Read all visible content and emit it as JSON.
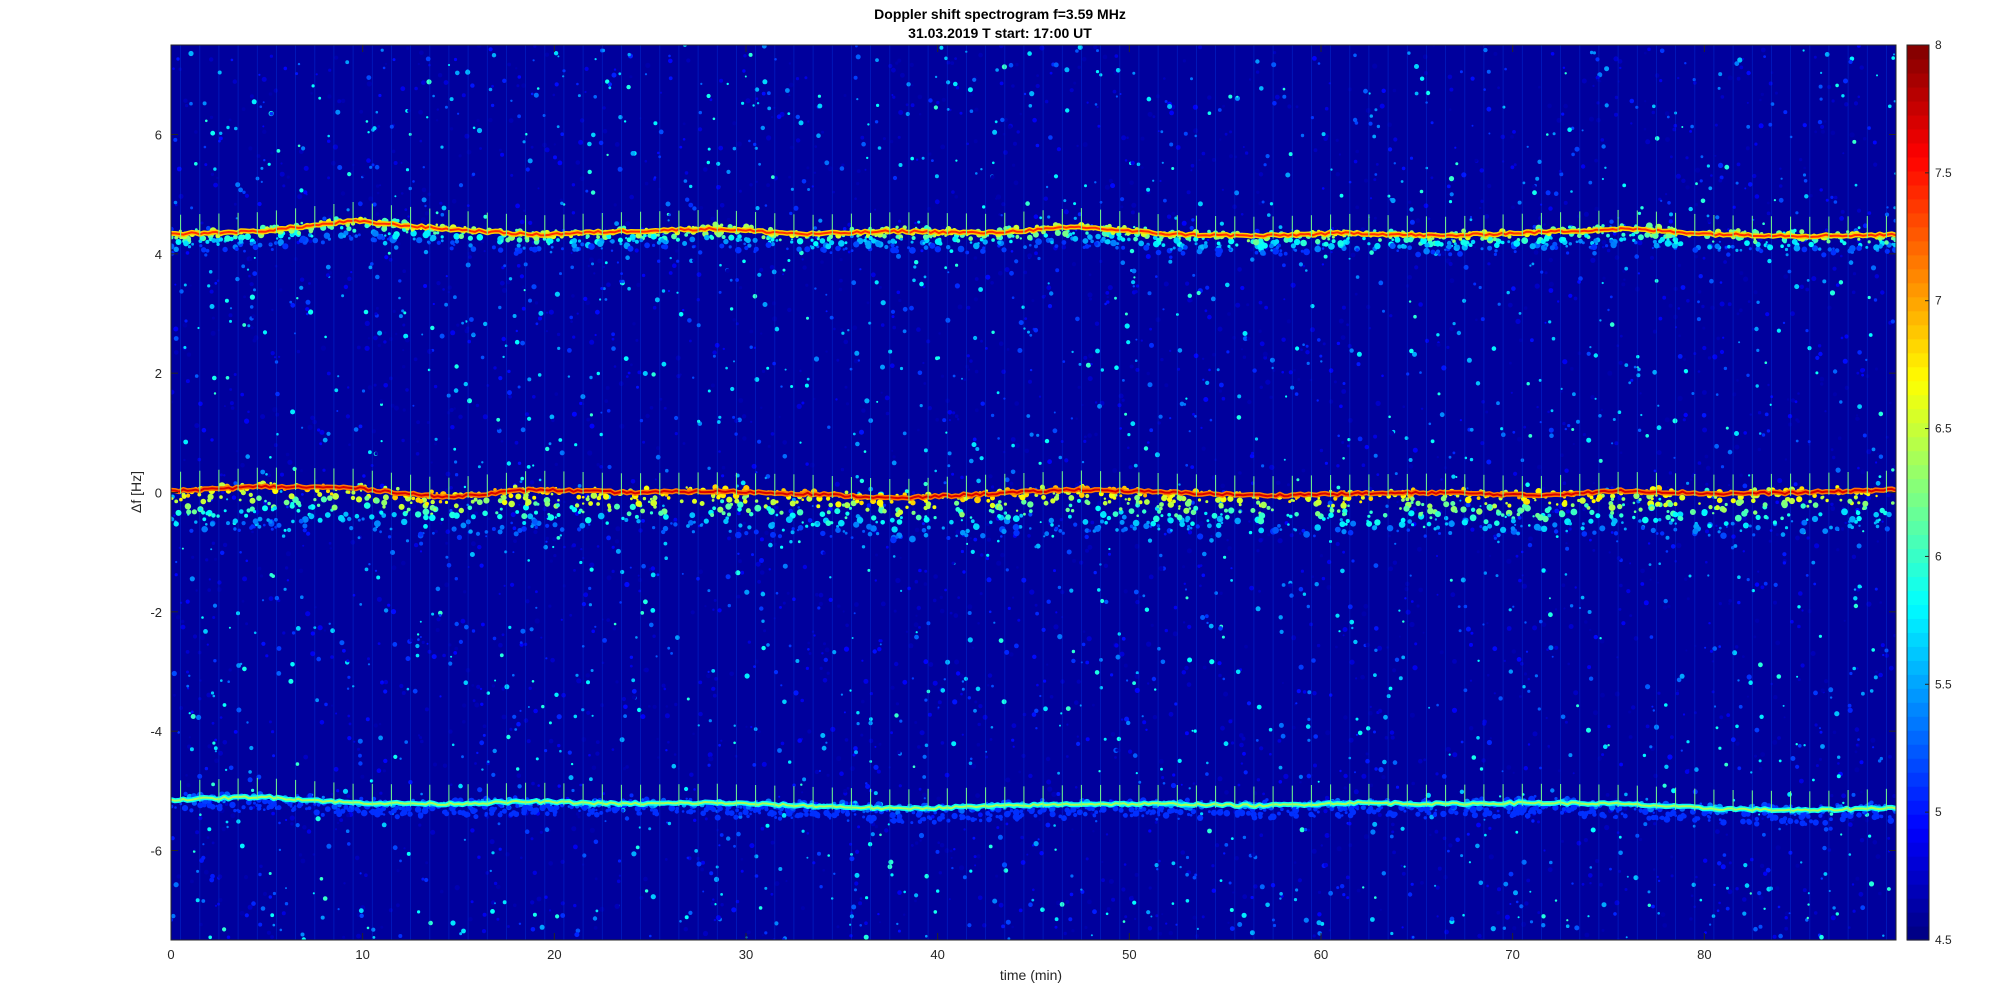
{
  "chart_data": {
    "type": "heatmap",
    "title": "Doppler shift spectrogram f=3.59 MHz",
    "subtitle": "31.03.2019   T start: 17:00 UT",
    "xlabel": "time (min)",
    "ylabel": "Δf [Hz]",
    "xlim": [
      0,
      90
    ],
    "ylim": [
      -7.5,
      7.5
    ],
    "x_ticks": [
      0,
      10,
      20,
      30,
      40,
      50,
      60,
      70,
      80
    ],
    "y_ticks": [
      -6,
      -4,
      -2,
      0,
      2,
      4,
      6
    ],
    "colorbar": {
      "range": [
        4.5,
        8
      ],
      "ticks": [
        4.5,
        5,
        5.5,
        6,
        6.5,
        7,
        7.5,
        8
      ],
      "colormap": "jet"
    },
    "background_level": 4.6,
    "traces": [
      {
        "freq": [
          4.33,
          4.38,
          4.55,
          4.42,
          4.32,
          4.38,
          4.42,
          4.33,
          4.38,
          4.35,
          4.45,
          4.33,
          4.3,
          4.35,
          4.3,
          4.36,
          4.42,
          4.33,
          4.3,
          4.32
        ],
        "peak": 7.4,
        "spread_below": 0.35
      },
      {
        "freq": [
          0.02,
          0.1,
          0.08,
          -0.08,
          0.05,
          0.0,
          0.02,
          -0.02,
          -0.1,
          -0.02,
          0.05,
          0.0,
          -0.05,
          -0.02,
          0.0,
          -0.05,
          0.03,
          -0.02,
          0.0,
          0.05
        ],
        "peak": 7.7,
        "spread_below": 0.75
      },
      {
        "freq": [
          -5.15,
          -5.1,
          -5.2,
          -5.22,
          -5.18,
          -5.22,
          -5.2,
          -5.25,
          -5.3,
          -5.26,
          -5.22,
          -5.22,
          -5.25,
          -5.2,
          -5.22,
          -5.2,
          -5.22,
          -5.3,
          -5.33,
          -5.28
        ],
        "peak": 6.4,
        "spread_below": 0.25
      }
    ]
  }
}
